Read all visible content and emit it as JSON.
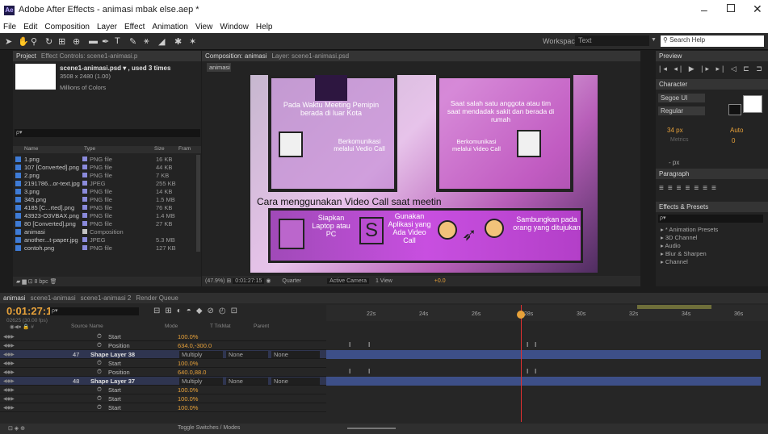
{
  "app": {
    "title": "Adobe After Effects - animasi mbak else.aep *",
    "logo": "Ae"
  },
  "menu": [
    "File",
    "Edit",
    "Composition",
    "Layer",
    "Effect",
    "Animation",
    "View",
    "Window",
    "Help"
  ],
  "toolbar": {
    "workspace_label": "Workspace:",
    "workspace_value": "Text",
    "search_placeholder": "Search Help"
  },
  "project": {
    "tab": "Project",
    "effect_tab": "Effect Controls: scene1-animasi.p",
    "file_name": "scene1-animasi.psd ▾ , used 3 times",
    "dims": "3508 x 2480 (1.00)",
    "colors": "Millions of Colors",
    "search_placeholder": "ρ▾",
    "headers": [
      "Name",
      "Type",
      "Size",
      "Fram"
    ],
    "items": [
      {
        "name": "1.png",
        "type": "PNG file",
        "size": "16 KB",
        "color": "#8a8adb"
      },
      {
        "name": "107 [Converted].png",
        "type": "PNG file",
        "size": "44 KB",
        "color": "#8a8adb"
      },
      {
        "name": "2.png",
        "type": "PNG file",
        "size": "7 KB",
        "color": "#8a8adb"
      },
      {
        "name": "2191786...or-text.jpg",
        "type": "JPEG",
        "size": "255 KB",
        "color": "#8a8adb"
      },
      {
        "name": "3.png",
        "type": "PNG file",
        "size": "14 KB",
        "color": "#8a8adb"
      },
      {
        "name": "345.png",
        "type": "PNG file",
        "size": "1.5 MB",
        "color": "#8a8adb"
      },
      {
        "name": "4185 [C...rted].png",
        "type": "PNG file",
        "size": "76 KB",
        "color": "#8a8adb"
      },
      {
        "name": "43923-O3VBAX.png",
        "type": "PNG file",
        "size": "1.4 MB",
        "color": "#8a8adb"
      },
      {
        "name": "80 [Converted].png",
        "type": "PNG file",
        "size": "27 KB",
        "color": "#8a8adb"
      },
      {
        "name": "animasi",
        "type": "Composition",
        "size": "",
        "color": "#c3c3c3"
      },
      {
        "name": "another...t-paper.jpg",
        "type": "JPEG",
        "size": "5.3 MB",
        "color": "#8a8adb"
      },
      {
        "name": "contoh.png",
        "type": "PNG file",
        "size": "127 KB",
        "color": "#8a8adb"
      }
    ],
    "bpc": "8 bpc"
  },
  "comp": {
    "tab": "Composition: animasi",
    "layer_tab": "Layer: scene1-animasi.psd",
    "subtab": "animasi",
    "scene": {
      "text1": "Pada Waktu Meeting Pemipin berada di luar Kota",
      "text2": "Saat salah satu anggota atau tim saat mendadak sakit dan berada di rumah",
      "text3": "Berkomunikasi melalui Vedio Call",
      "text4": "Berkomunikasi melalui Video Call",
      "banner": "Cara menggunakan Video Call saat meetin",
      "step1": "Siapkan Laptop atau PC",
      "step2": "Gunakan Aplikasi yang Ada Video Call",
      "step3": "Sambungkan pada orang yang ditujukan",
      "step_letter": "S"
    },
    "footer": {
      "zoom": "(47.9%)",
      "time": "0:01:27:15",
      "res": "Quarter",
      "camera": "Active Camera",
      "view": "1 View",
      "offset": "+0.0"
    }
  },
  "right": {
    "preview_tab": "Preview",
    "character_tab": "Character",
    "font": "Segoe UI",
    "style": "Regular",
    "size": "34 px",
    "leading": "Auto",
    "tracking": "Metrics",
    "tracking_val": "0",
    "px": "- px",
    "paragraph_tab": "Paragraph",
    "effects_tab": "Effects & Presets",
    "search_placeholder": "ρ▾",
    "effects": [
      "▸ * Animation Presets",
      "▸ 3D Channel",
      "▸ Audio",
      "▸ Blur & Sharpen",
      "▸ Channel"
    ]
  },
  "timeline": {
    "tabs": [
      "animasi",
      "scene1-animasi",
      "scene1-animasi 2",
      "Render Queue"
    ],
    "time": "0:01:27:15",
    "frames": "02625 (30.00 fps)",
    "search_placeholder": "ρ▾",
    "headers": {
      "source": "Source Name",
      "mode": "Mode",
      "trkmat": "T TrkMat",
      "parent": "Parent"
    },
    "ruler": [
      "22s",
      "24s",
      "26s",
      "28s",
      "30s",
      "32s",
      "34s",
      "36s"
    ],
    "rows": [
      {
        "kind": "prop",
        "name": "Start",
        "value": "100.0%"
      },
      {
        "kind": "prop",
        "name": "Position",
        "value": "634.0,-300.0"
      },
      {
        "kind": "layer",
        "num": "47",
        "name": "Shape Layer 38",
        "mode": "Multiply",
        "trk": "None",
        "parent": "None"
      },
      {
        "kind": "prop",
        "name": "Start",
        "value": "100.0%"
      },
      {
        "kind": "prop",
        "name": "Position",
        "value": "640.0,88.0"
      },
      {
        "kind": "layer",
        "num": "48",
        "name": "Shape Layer 37",
        "mode": "Multiply",
        "trk": "None",
        "parent": "None"
      },
      {
        "kind": "prop",
        "name": "Start",
        "value": "100.0%"
      },
      {
        "kind": "prop",
        "name": "Start",
        "value": "100.0%"
      },
      {
        "kind": "prop",
        "name": "Start",
        "value": "100.0%"
      }
    ],
    "toggle": "Toggle Switches / Modes"
  }
}
